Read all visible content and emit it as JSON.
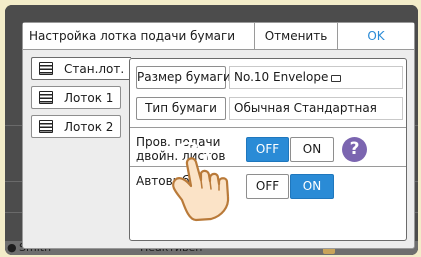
{
  "dialog": {
    "title": "Настройка лотка подачи бумаги",
    "cancel_label": "Отменить",
    "ok_label": "OK"
  },
  "tabs": [
    {
      "label": "Стан.лот.",
      "selected": true,
      "icon": "tray-icon"
    },
    {
      "label": "Лоток 1",
      "selected": false,
      "icon": "tray-icon"
    },
    {
      "label": "Лоток 2",
      "selected": false,
      "icon": "tray-icon"
    }
  ],
  "settings": {
    "paper_size": {
      "button_label": "Размер бумаги",
      "value": "No.10 Envelope",
      "orientation_icon": "landscape-envelope-icon"
    },
    "paper_type": {
      "button_label": "Тип бумаги",
      "value": "Обычная Стандартная"
    },
    "double_feed": {
      "label_line1": "Пров. подачи",
      "label_line2": "двойн. листов",
      "off_label": "OFF",
      "on_label": "ON",
      "selected": "OFF",
      "help_label": "?"
    },
    "auto_select": {
      "label": "Автовыбор",
      "off_label": "OFF",
      "on_label": "ON",
      "selected": "ON"
    }
  },
  "background_row": {
    "left_text": "Smith",
    "middle_text": "Неактивен"
  },
  "colors": {
    "accent": "#2a8bd6",
    "help": "#7b65b0",
    "outer_background": "#f3ecc9"
  }
}
